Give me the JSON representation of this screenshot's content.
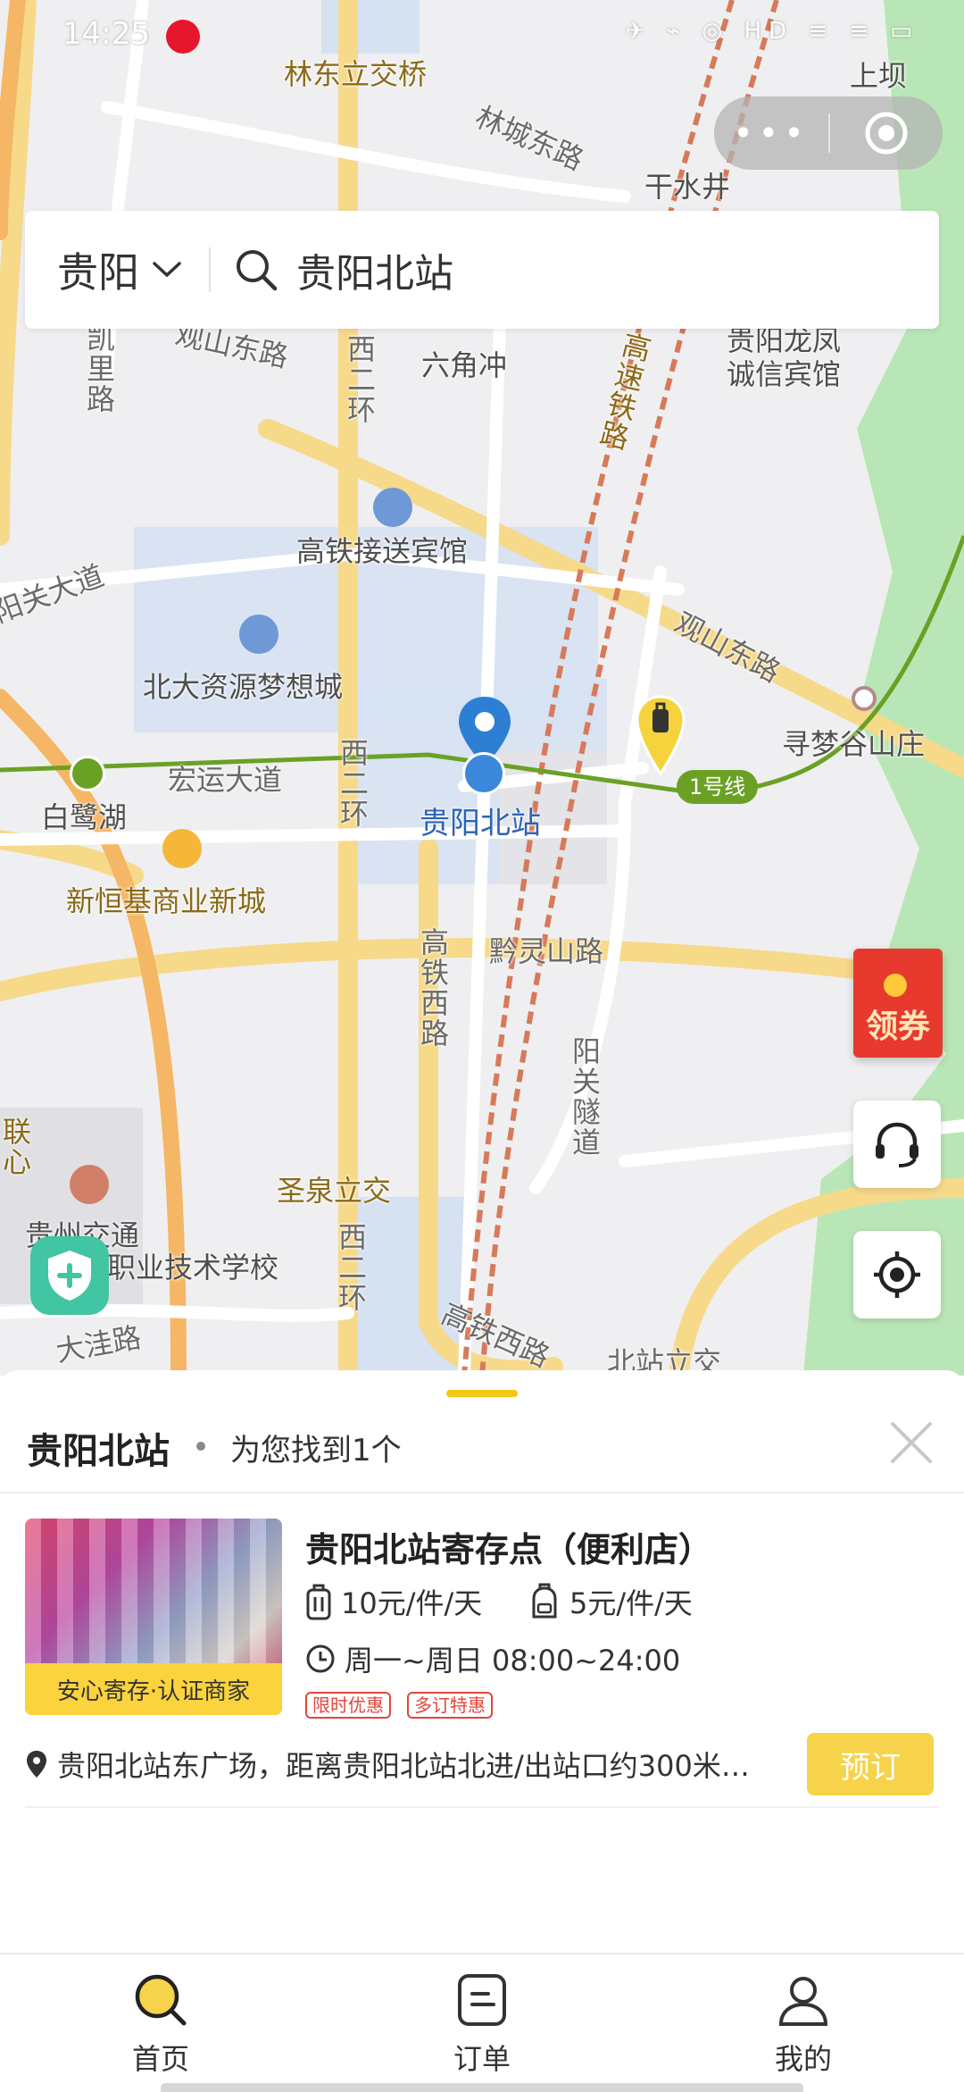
{
  "status_bar": {
    "time": "14:25",
    "icons_text": "✈ ⌁ ◎ HD ≡ ≡ ▭"
  },
  "capsule": {
    "more": "•••"
  },
  "search": {
    "city": "贵阳",
    "query": "贵阳北站"
  },
  "map": {
    "labels": {
      "l1": "林东立交桥",
      "l2": "林城东路",
      "l3": "上坝",
      "l4": "干水井",
      "l5": "西二环",
      "l6": "六角冲",
      "l7": "贵阳龙凤",
      "l8": "诚信宾馆",
      "l9": "高速铁路",
      "l10": "观山东路",
      "l11": "凯里路",
      "l12": "高铁接送宾馆",
      "l13": "阳关大道",
      "l14": "观山东路",
      "l15": "北大资源梦想城",
      "l16": "寻梦谷山庄",
      "l17": "宏运大道",
      "l18": "西二环",
      "l19": "白鹭湖",
      "l20": "贵阳北站",
      "l21": "新恒基商业新城",
      "l22": "高铁西路",
      "l23": "黔灵山路",
      "l24": "阳关隧道",
      "l25": "圣泉立交",
      "l26": "西二环",
      "l27": "贵州交通",
      "l28": "职业技术学校",
      "l29": "大洼路",
      "l30": "高铁西路",
      "l31": "北站立交",
      "line_badge": "1号线",
      "l_edge1": "联心"
    }
  },
  "coupon": {
    "label": "领券"
  },
  "sheet": {
    "title": "贵阳北站",
    "count_text": "为您找到1个",
    "store": {
      "name": "贵阳北站寄存点（便利店）",
      "badge": "安心寄存·认证商家",
      "price_luggage": "10元/件/天",
      "price_bag": "5元/件/天",
      "hours": "周一~周日 08:00~24:00",
      "tags": [
        "限时优惠",
        "多订特惠"
      ],
      "address": "贵阳北站东广场，距离贵阳北站北进/出站口约300米…",
      "book_label": "预订"
    }
  },
  "tabs": [
    {
      "label": "首页",
      "active": true
    },
    {
      "label": "订单",
      "active": false
    },
    {
      "label": "我的",
      "active": false
    }
  ],
  "colors": {
    "accent": "#f6d34a",
    "metro_line": "#6aa125",
    "station_blue": "#2d7fd3",
    "tag_red": "#e2463d"
  }
}
